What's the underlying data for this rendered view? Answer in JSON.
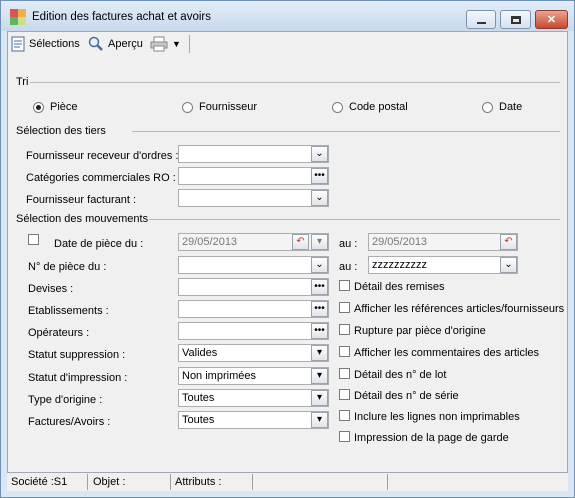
{
  "window": {
    "title": "Edition des factures achat et avoirs"
  },
  "toolbar": {
    "selections_label": "Sélections",
    "preview_label": "Aperçu"
  },
  "tri": {
    "title": "Tri",
    "options": [
      "Pièce",
      "Fournisseur",
      "Code postal",
      "Date"
    ],
    "selected": "Pièce"
  },
  "tiers": {
    "title": "Sélection des tiers",
    "fournisseur_receveur_label": "Fournisseur receveur d'ordres :",
    "categories_label": "Catégories commerciales RO :",
    "fournisseur_facturant_label": "Fournisseur facturant :"
  },
  "mouvements": {
    "title": "Sélection des mouvements",
    "date_du_label": "Date de pièce du :",
    "date_du_value": "29/05/2013",
    "au_label": "au :",
    "date_au_value": "29/05/2013",
    "num_du_label": "N° de pièce du :",
    "num_au_label": "au :",
    "num_au_value": "zzzzzzzzzz",
    "devises_label": "Devises :",
    "etablissements_label": "Etablissements :",
    "operateurs_label": "Opérateurs :",
    "statut_suppression_label": "Statut suppression :",
    "statut_suppression_value": "Valides",
    "statut_impression_label": "Statut d'impression :",
    "statut_impression_value": "Non imprimées",
    "type_origine_label": "Type d'origine :",
    "type_origine_value": "Toutes",
    "factures_avoirs_label": "Factures/Avoirs :",
    "factures_avoirs_value": "Toutes"
  },
  "options": {
    "detail_remises": "Détail des remises",
    "afficher_references": "Afficher les références articles/fournisseurs",
    "rupture_piece": "Rupture par pièce d'origine",
    "afficher_commentaires": "Afficher les commentaires des articles",
    "detail_lot": "Détail des n° de lot",
    "detail_serie": "Détail des n° de série",
    "inclure_lignes": "Inclure les lignes non imprimables",
    "impression_garde": "Impression de la page de garde"
  },
  "status": {
    "societe": "Société :S1",
    "objet": "Objet :",
    "attributs": "Attributs :"
  }
}
